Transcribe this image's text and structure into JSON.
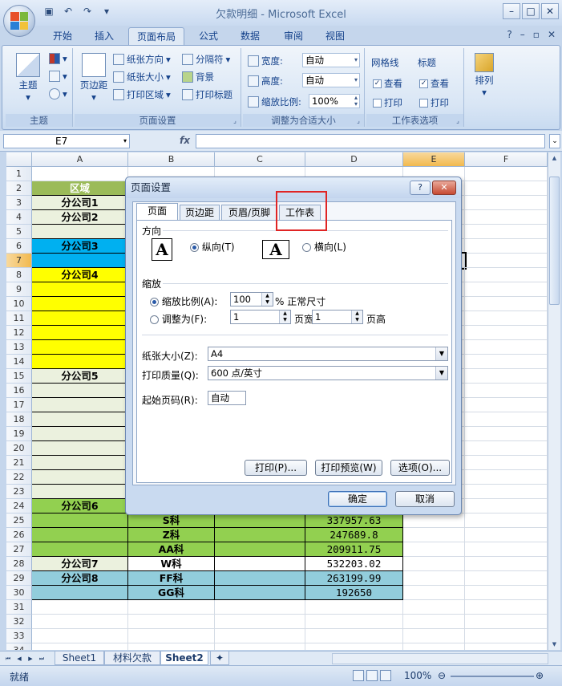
{
  "window": {
    "title": "欠款明细 - Microsoft Excel"
  },
  "ribbon_tabs": [
    "开始",
    "插入",
    "页面布局",
    "公式",
    "数据",
    "审阅",
    "视图"
  ],
  "ribbon": {
    "theme": {
      "label": "主题",
      "group": "主题"
    },
    "page_setup": {
      "margins": "页边距",
      "orientation": "纸张方向",
      "size": "纸张大小",
      "print_area": "打印区域",
      "breaks": "分隔符",
      "background": "背景",
      "print_titles": "打印标题",
      "group": "页面设置"
    },
    "scale": {
      "width_label": "宽度:",
      "width_value": "自动",
      "height_label": "高度:",
      "height_value": "自动",
      "scale_label": "缩放比例:",
      "scale_value": "100%",
      "group": "调整为合适大小"
    },
    "sheet_options": {
      "gridlines": "网格线",
      "headings": "标题",
      "view": "查看",
      "print": "打印",
      "group": "工作表选项"
    },
    "arrange": {
      "label": "排列"
    }
  },
  "formula_bar": {
    "name_box": "E7",
    "fx": "fx"
  },
  "columns": [
    "A",
    "B",
    "C",
    "D",
    "E",
    "F"
  ],
  "cells": {
    "A2": "区域",
    "A3": "分公司1",
    "A4": "分公司2",
    "A6": "分公司3",
    "A8": "分公司4",
    "A15": "分公司5",
    "A24": "分公司6",
    "A28": "分公司7",
    "A29": "分公司8",
    "B25": "S科",
    "B26": "Z科",
    "B27": "AA科",
    "B28": "W科",
    "B29": "FF科",
    "B30": "GG科",
    "D25": "337957.63",
    "D26": "247689.8",
    "D27": "209911.75",
    "D28": "532203.02",
    "D29": "263199.99",
    "D30": "192650"
  },
  "sheet_tabs": [
    "Sheet1",
    "材料欠款",
    "Sheet2"
  ],
  "status": {
    "ready": "就绪",
    "zoom": "100%"
  },
  "dialog": {
    "title": "页面设置",
    "help": "?",
    "tabs": [
      "页面",
      "页边距",
      "页眉/页脚",
      "工作表"
    ],
    "orientation_label": "方向",
    "portrait": "纵向(T)",
    "landscape": "横向(L)",
    "scaling_label": "缩放",
    "adjust_scale": "缩放比例(A):",
    "scale_value": "100",
    "normal_size": "% 正常尺寸",
    "fit_to": "调整为(F):",
    "pages_wide_value": "1",
    "pages_wide": "页宽",
    "pages_tall_value": "1",
    "pages_tall": "页高",
    "paper_size_label": "纸张大小(Z):",
    "paper_size": "A4",
    "print_quality_label": "打印质量(Q):",
    "print_quality": "600 点/英寸",
    "first_page_label": "起始页码(R):",
    "first_page": "自动",
    "print_btn": "打印(P)...",
    "preview_btn": "打印预览(W)",
    "options_btn": "选项(O)...",
    "ok": "确定",
    "cancel": "取消"
  },
  "colors": {
    "olive": "#9bbb59",
    "green": "#92d050",
    "lightgreen": "#ebf1de",
    "cyan": "#00b0f0",
    "yellow": "#ffff00",
    "teal": "#92cddc",
    "highlight": "#e02424"
  }
}
